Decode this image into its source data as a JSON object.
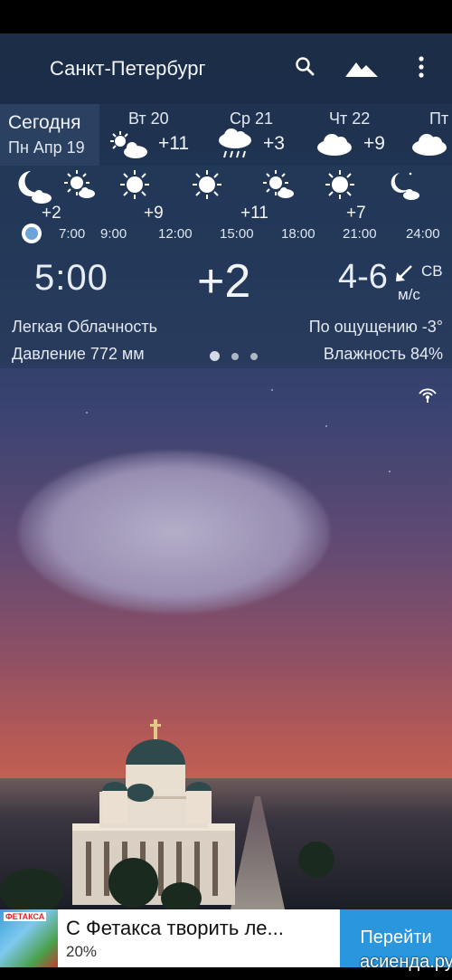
{
  "app": {
    "city": "Санкт-Петербург",
    "icons": [
      "search-icon",
      "landscape-icon",
      "more-vert-icon",
      "radar-icon"
    ]
  },
  "today": {
    "label": "Сегодня",
    "date": "Пн Апр 19"
  },
  "days": [
    {
      "name": "Вт 20",
      "temp": "+11",
      "icon": "partly-sunny-icon"
    },
    {
      "name": "Ср 21",
      "temp": "+3",
      "icon": "rain-cloud-icon"
    },
    {
      "name": "Чт 22",
      "temp": "+9",
      "icon": "cloud-icon"
    },
    {
      "name": "Пт",
      "temp": "",
      "icon": "cloud-icon"
    }
  ],
  "hourly": {
    "temps": [
      "+2",
      "+9",
      "+11",
      "+7"
    ],
    "times": [
      "7:00",
      "9:00",
      "12:00",
      "15:00",
      "18:00",
      "21:00",
      "24:00"
    ],
    "icons": [
      "moon-cloud-icon",
      "sun-cloud-icon",
      "sun-icon",
      "sun-icon",
      "sun-cloud-icon",
      "sun-icon",
      "moon-cloud-icon"
    ]
  },
  "current": {
    "time": "5:00",
    "temp": "+2",
    "wind": "4-6",
    "wind_dir": "СВ",
    "wind_unit": "м/с",
    "condition": "Легкая Облачность",
    "feels_like": "По ощущению -3°",
    "pressure": "Давление 772 мм",
    "humidity": "Влажность 84%"
  },
  "ad": {
    "brand": "ФЕТАКСА",
    "title": "С Фетакса творить ле...",
    "subtitle": "20%",
    "button": "Перейти"
  },
  "watermark": "асиенда.ру"
}
